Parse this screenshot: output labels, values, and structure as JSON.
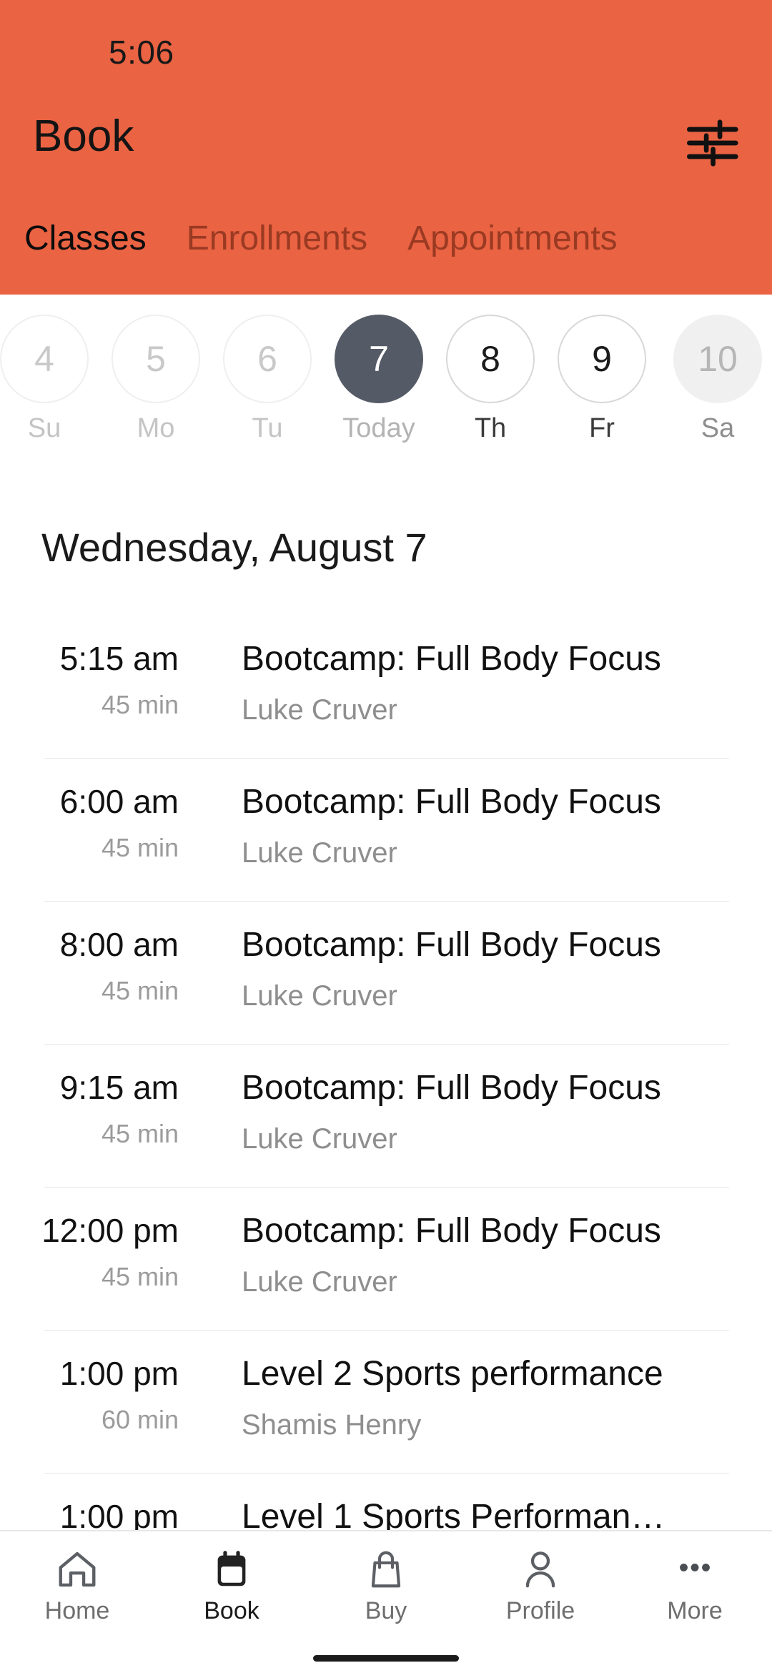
{
  "status_bar": {
    "time": "5:06"
  },
  "header": {
    "title": "Book",
    "background_color": "#EA6343",
    "filter_icon": "tune-icon",
    "tabs": [
      {
        "label": "Classes",
        "active": true
      },
      {
        "label": "Enrollments",
        "active": false
      },
      {
        "label": "Appointments",
        "active": false
      }
    ]
  },
  "day_strip": {
    "days": [
      {
        "number": "4",
        "label": "Su",
        "state": "past"
      },
      {
        "number": "5",
        "label": "Mo",
        "state": "past"
      },
      {
        "number": "6",
        "label": "Tu",
        "state": "past"
      },
      {
        "number": "7",
        "label": "Today",
        "state": "today"
      },
      {
        "number": "8",
        "label": "Th",
        "state": "future"
      },
      {
        "number": "9",
        "label": "Fr",
        "state": "future"
      },
      {
        "number": "10",
        "label": "Sa",
        "state": "edge"
      }
    ],
    "selected_color": "#555B66"
  },
  "schedule": {
    "date_heading": "Wednesday, August 7",
    "classes": [
      {
        "time": "5:15 am",
        "duration": "45 min",
        "title": "Bootcamp: Full Body Focus",
        "instructor": "Luke Cruver"
      },
      {
        "time": "6:00 am",
        "duration": "45 min",
        "title": "Bootcamp: Full Body Focus",
        "instructor": "Luke Cruver"
      },
      {
        "time": "8:00 am",
        "duration": "45 min",
        "title": "Bootcamp: Full Body Focus",
        "instructor": "Luke Cruver"
      },
      {
        "time": "9:15 am",
        "duration": "45 min",
        "title": "Bootcamp: Full Body Focus",
        "instructor": "Luke Cruver"
      },
      {
        "time": "12:00 pm",
        "duration": "45 min",
        "title": "Bootcamp: Full Body Focus",
        "instructor": "Luke Cruver"
      },
      {
        "time": "1:00 pm",
        "duration": "60 min",
        "title": "Level 2 Sports performance",
        "instructor": "Shamis Henry"
      },
      {
        "time": "1:00 pm",
        "duration": "",
        "title": "Level 1 Sports Performan…",
        "instructor": ""
      }
    ]
  },
  "bottom_nav": {
    "items": [
      {
        "label": "Home",
        "icon": "home-icon",
        "active": false
      },
      {
        "label": "Book",
        "icon": "calendar-icon",
        "active": true
      },
      {
        "label": "Buy",
        "icon": "bag-icon",
        "active": false
      },
      {
        "label": "Profile",
        "icon": "person-icon",
        "active": false
      },
      {
        "label": "More",
        "icon": "dots-icon",
        "active": false
      }
    ]
  }
}
